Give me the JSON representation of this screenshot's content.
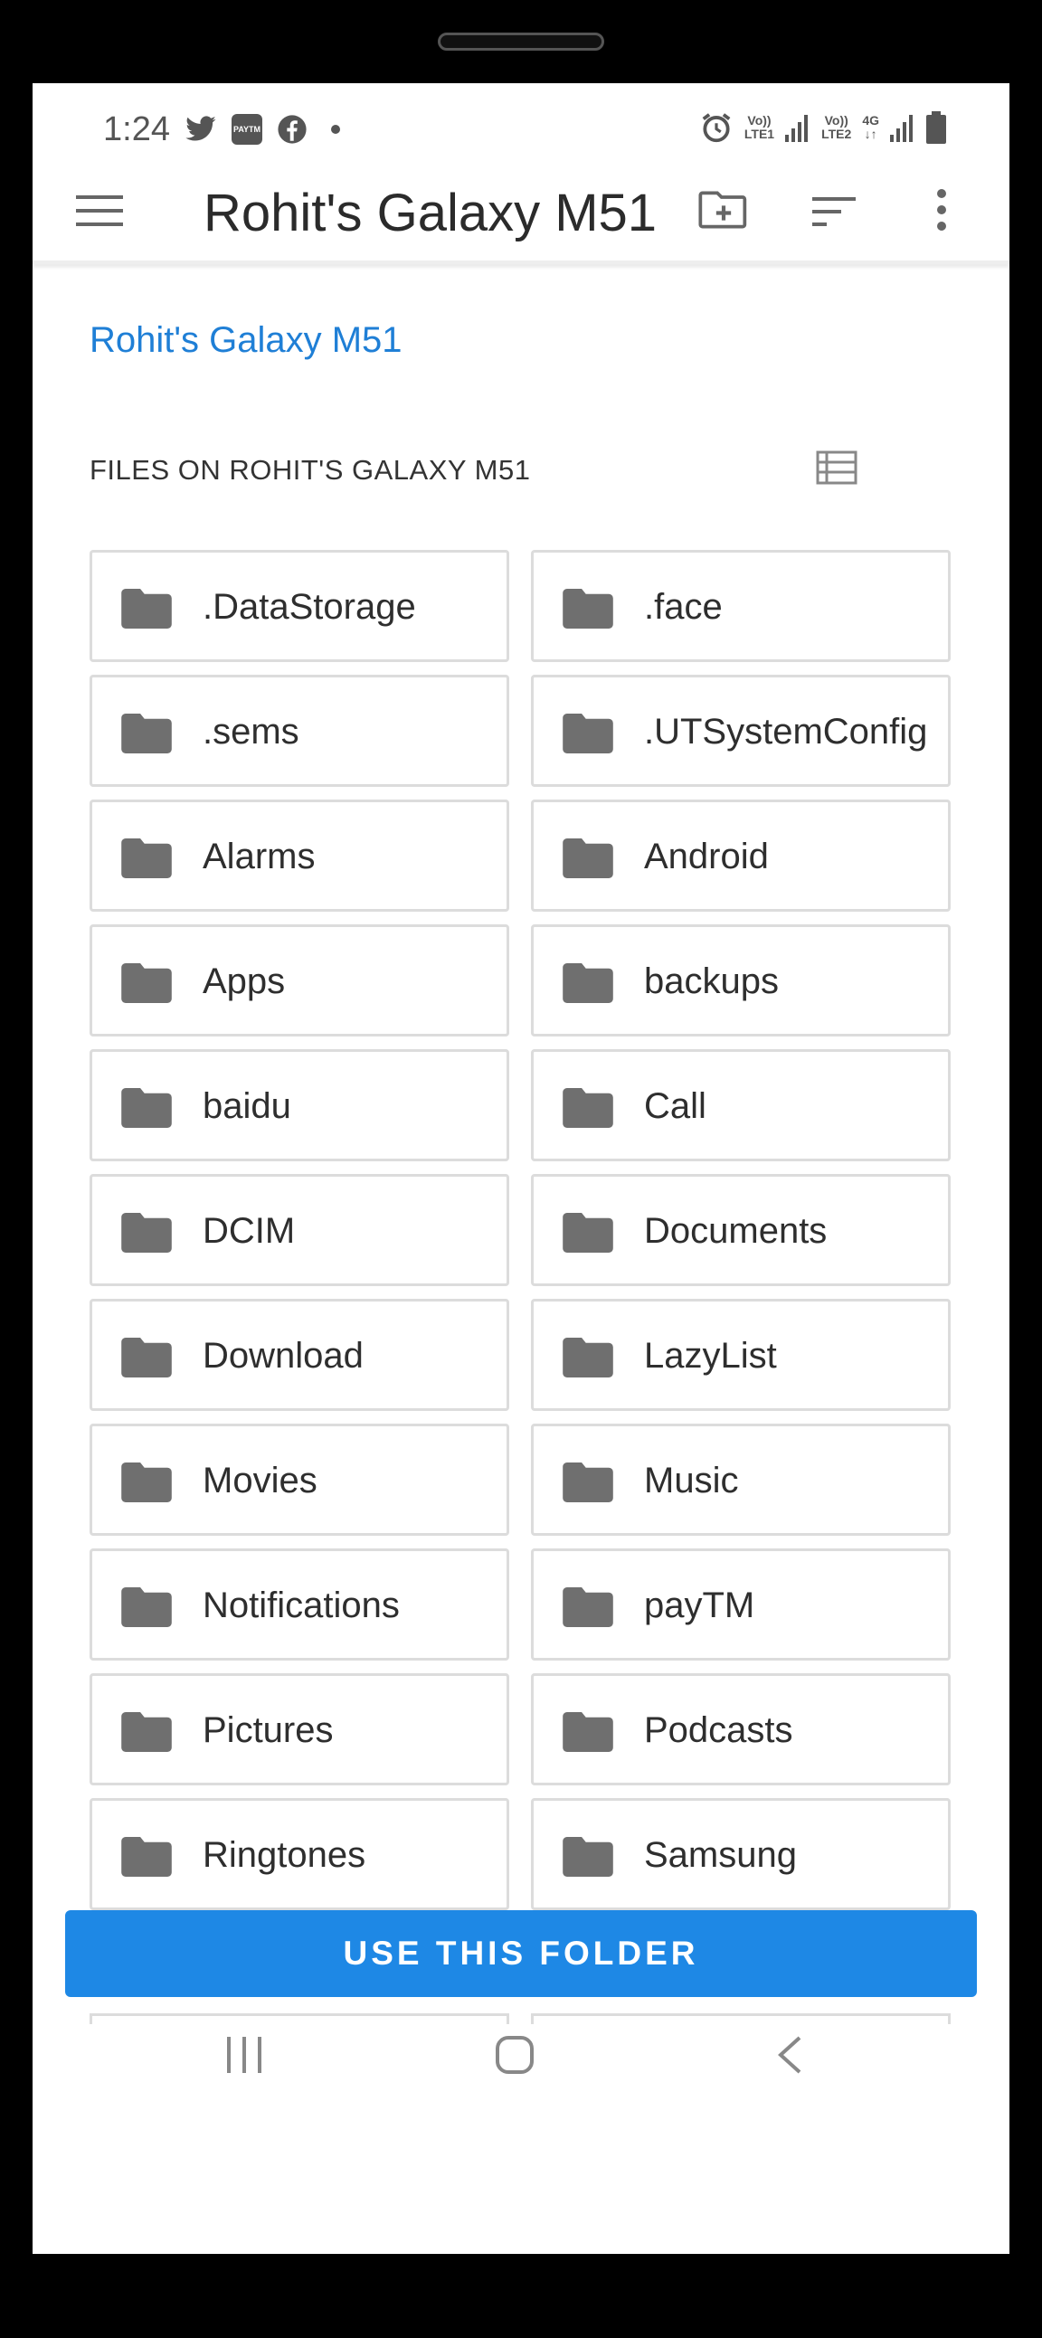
{
  "status_bar": {
    "time": "1:24",
    "left_icons": [
      "twitter-icon",
      "paytm-icon",
      "facebook-icon",
      "dot-icon"
    ],
    "paytm_text": "PAYTM",
    "sim1": {
      "top": "Vo))",
      "bottom": "LTE1"
    },
    "sim2": {
      "top": "Vo))",
      "bottom": "LTE2"
    },
    "network": "4G",
    "right_icons": [
      "alarm-icon",
      "signal-icon",
      "signal-icon",
      "signal-icon",
      "battery-icon"
    ]
  },
  "app_bar": {
    "title": "Rohit's Galaxy M51",
    "icons": [
      "menu-icon",
      "new-folder-icon",
      "sort-icon",
      "more-vert-icon"
    ]
  },
  "breadcrumb": "Rohit's Galaxy M51",
  "section_label": "FILES ON ROHIT'S GALAXY M51",
  "folders": [
    ".DataStorage",
    ".face",
    ".sems",
    ".UTSystemConfig",
    "Alarms",
    "Android",
    "Apps",
    "backups",
    "baidu",
    "Call",
    "DCIM",
    "Documents",
    "Download",
    "LazyList",
    "Movies",
    "Music",
    "Notifications",
    "payTM",
    "Pictures",
    "Podcasts",
    "Ringtones",
    "Samsung"
  ],
  "primary_button": "USE THIS FOLDER",
  "colors": {
    "accent": "#1e88e5",
    "link": "#1f7fd6",
    "folder_icon": "#6f6f6f",
    "tile_border": "#dcdcdc"
  },
  "nav_bar": [
    "recents-icon",
    "home-icon",
    "back-icon"
  ]
}
